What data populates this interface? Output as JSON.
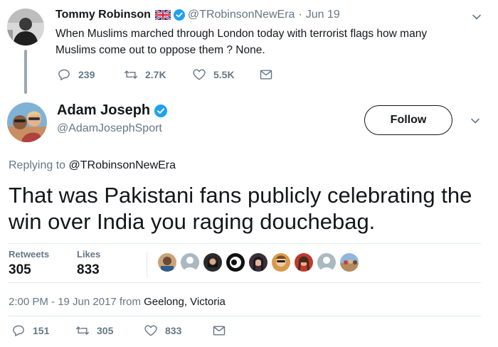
{
  "parent": {
    "name": "Tommy Robinson",
    "handle": "@TRobinsonNewEra",
    "date": "Jun 19",
    "separator": "·",
    "text": "When Muslims marched through London today with terrorist flags how many Muslims come out to oppose them ? None.",
    "actions": {
      "replies": "239",
      "retweets": "2.7K",
      "likes": "5.5K"
    }
  },
  "main": {
    "name": "Adam Joseph",
    "handle": "@AdamJosephSport",
    "follow_label": "Follow",
    "replying_prefix": "Replying to",
    "replying_handle": "@TRobinsonNewEra",
    "text": "That was Pakistani fans publicly celebrating the win over India you raging douchebag.",
    "stats": {
      "retweets_label": "Retweets",
      "retweets_value": "305",
      "likes_label": "Likes",
      "likes_value": "833"
    },
    "timestamp": "2:00 PM - 19 Jun 2017 from",
    "location": "Geelong, Victoria",
    "actions": {
      "replies": "151",
      "retweets": "305",
      "likes": "833"
    }
  },
  "colors": {
    "text": "#14171a",
    "muted": "#657786",
    "verified": "#1da1f2",
    "divider": "#e1e8ed"
  },
  "icons": [
    "reply-icon",
    "retweet-icon",
    "heart-icon",
    "envelope-icon",
    "chevron-down-icon",
    "verified-badge-icon",
    "uk-flag-icon"
  ]
}
